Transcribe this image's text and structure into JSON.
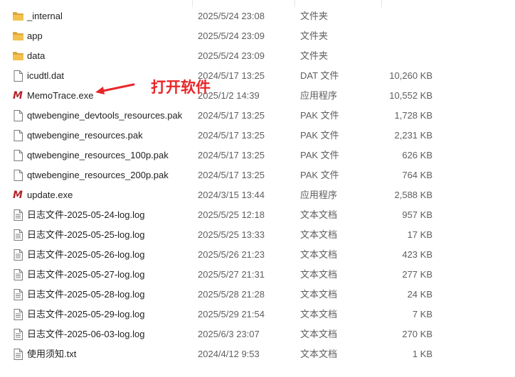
{
  "colors": {
    "folder": "#f2c14e",
    "folder_dark": "#dca63a",
    "app_icon": "#b3262b",
    "annotation": "#e8262a"
  },
  "annotation": {
    "text": "打开软件"
  },
  "files": [
    {
      "icon": "folder-icon",
      "name": "_internal",
      "date": "2025/5/24 23:08",
      "type": "文件夹",
      "size": ""
    },
    {
      "icon": "folder-icon",
      "name": "app",
      "date": "2025/5/24 23:09",
      "type": "文件夹",
      "size": ""
    },
    {
      "icon": "folder-icon",
      "name": "data",
      "date": "2025/5/24 23:09",
      "type": "文件夹",
      "size": ""
    },
    {
      "icon": "file-icon",
      "name": "icudtl.dat",
      "date": "2024/5/17 13:25",
      "type": "DAT 文件",
      "size": "10,260 KB"
    },
    {
      "icon": "app-icon",
      "name": "MemoTrace.exe",
      "date": "2025/1/2 14:39",
      "type": "应用程序",
      "size": "10,552 KB"
    },
    {
      "icon": "file-icon",
      "name": "qtwebengine_devtools_resources.pak",
      "date": "2024/5/17 13:25",
      "type": "PAK 文件",
      "size": "1,728 KB"
    },
    {
      "icon": "file-icon",
      "name": "qtwebengine_resources.pak",
      "date": "2024/5/17 13:25",
      "type": "PAK 文件",
      "size": "2,231 KB"
    },
    {
      "icon": "file-icon",
      "name": "qtwebengine_resources_100p.pak",
      "date": "2024/5/17 13:25",
      "type": "PAK 文件",
      "size": "626 KB"
    },
    {
      "icon": "file-icon",
      "name": "qtwebengine_resources_200p.pak",
      "date": "2024/5/17 13:25",
      "type": "PAK 文件",
      "size": "764 KB"
    },
    {
      "icon": "app-icon",
      "name": "update.exe",
      "date": "2024/3/15 13:44",
      "type": "应用程序",
      "size": "2,588 KB"
    },
    {
      "icon": "text-file-icon",
      "name": "日志文件-2025-05-24-log.log",
      "date": "2025/5/25 12:18",
      "type": "文本文档",
      "size": "957 KB"
    },
    {
      "icon": "text-file-icon",
      "name": "日志文件-2025-05-25-log.log",
      "date": "2025/5/25 13:33",
      "type": "文本文档",
      "size": "17 KB"
    },
    {
      "icon": "text-file-icon",
      "name": "日志文件-2025-05-26-log.log",
      "date": "2025/5/26 21:23",
      "type": "文本文档",
      "size": "423 KB"
    },
    {
      "icon": "text-file-icon",
      "name": "日志文件-2025-05-27-log.log",
      "date": "2025/5/27 21:31",
      "type": "文本文档",
      "size": "277 KB"
    },
    {
      "icon": "text-file-icon",
      "name": "日志文件-2025-05-28-log.log",
      "date": "2025/5/28 21:28",
      "type": "文本文档",
      "size": "24 KB"
    },
    {
      "icon": "text-file-icon",
      "name": "日志文件-2025-05-29-log.log",
      "date": "2025/5/29 21:54",
      "type": "文本文档",
      "size": "7 KB"
    },
    {
      "icon": "text-file-icon",
      "name": "日志文件-2025-06-03-log.log",
      "date": "2025/6/3 23:07",
      "type": "文本文档",
      "size": "270 KB"
    },
    {
      "icon": "text-file-icon",
      "name": "使用须知.txt",
      "date": "2024/4/12 9:53",
      "type": "文本文档",
      "size": "1 KB"
    }
  ]
}
